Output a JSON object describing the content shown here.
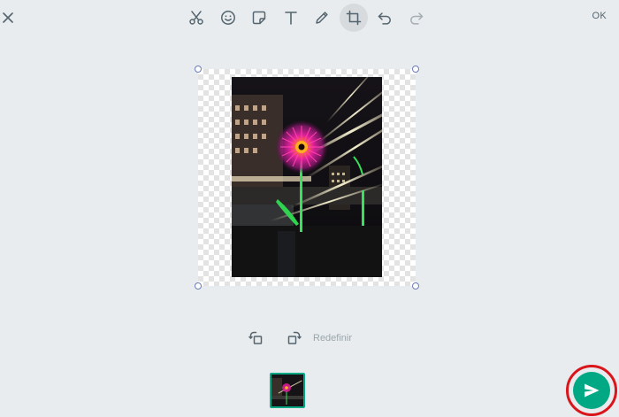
{
  "toolbar": {
    "close_icon": "close-icon",
    "tools": [
      "scissors-icon",
      "emoji-icon",
      "sticker-icon",
      "text-icon",
      "pencil-icon",
      "crop-icon",
      "undo-icon",
      "redo-icon"
    ],
    "ok_label": "OK"
  },
  "crop": {
    "reset_label": "Redefinir"
  },
  "colors": {
    "accent": "#00a884",
    "highlight_ring": "#d9161b",
    "background": "#e9ecee",
    "icon": "#54656f"
  }
}
